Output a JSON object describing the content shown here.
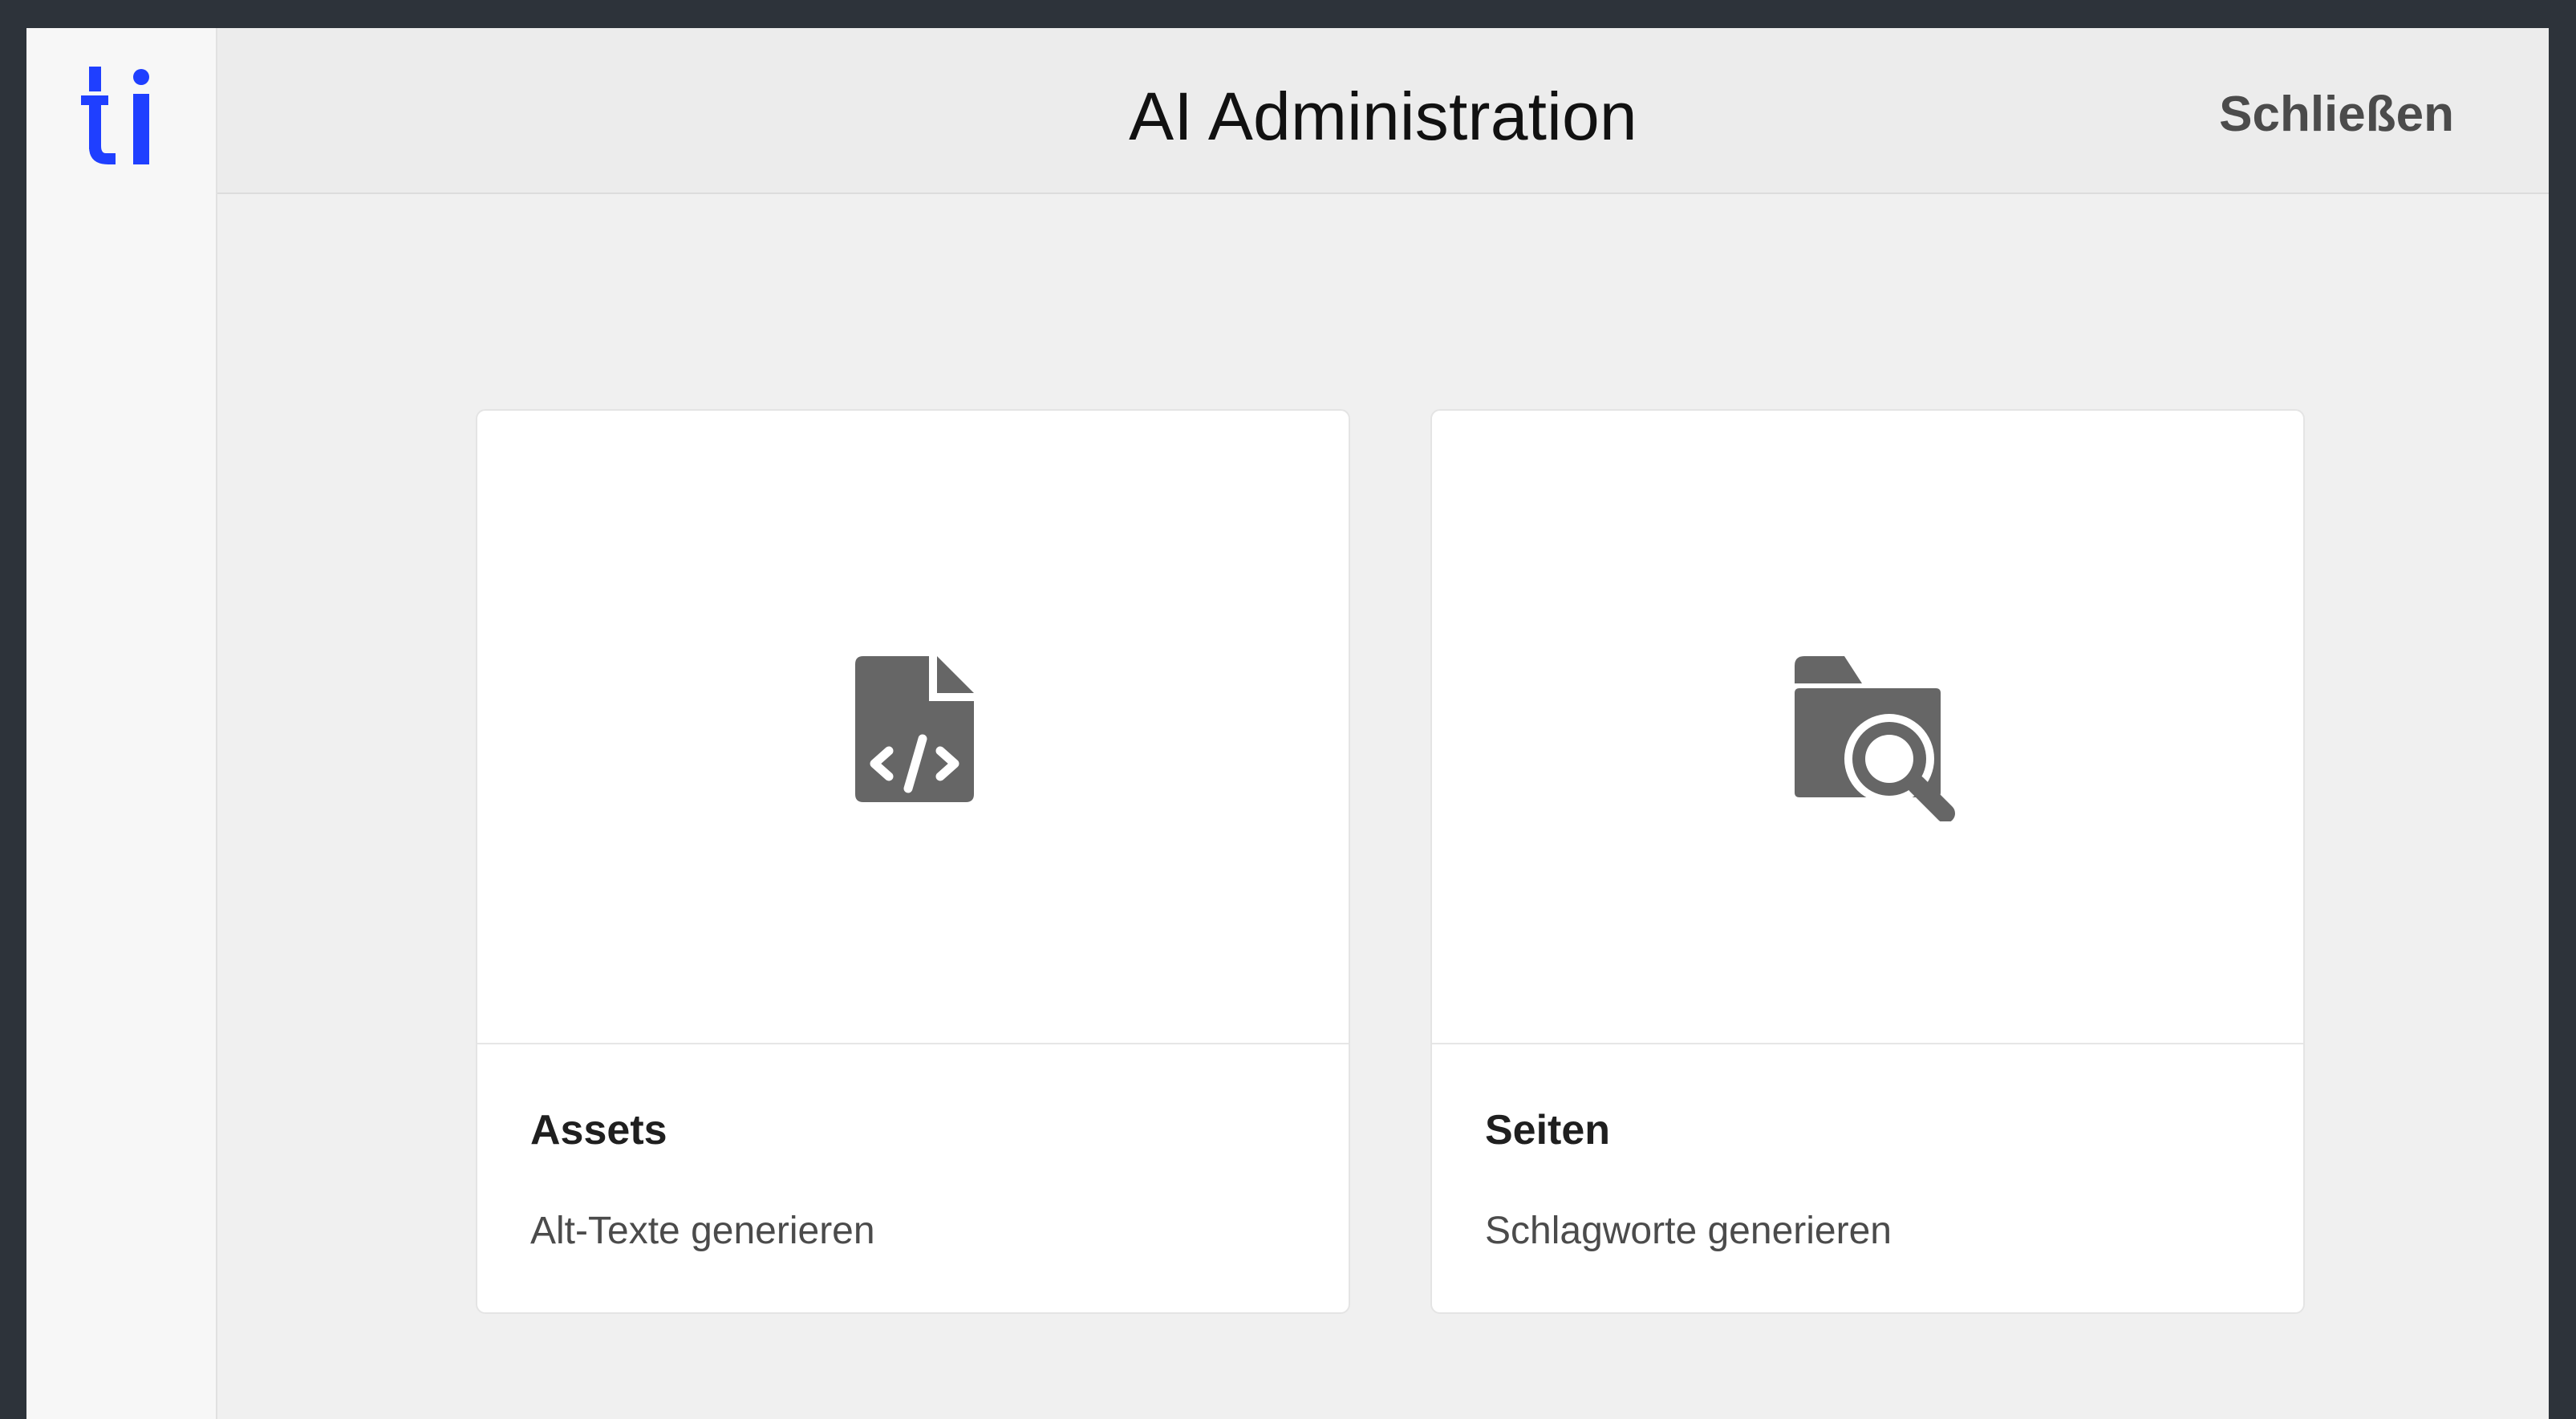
{
  "app": {
    "logo_text": "ti",
    "logo_color": "#1f3fff"
  },
  "header": {
    "title": "AI Administration",
    "close_label": "Schließen"
  },
  "cards": [
    {
      "title": "Assets",
      "subtitle": "Alt-Texte generieren",
      "icon": "file-code-icon"
    },
    {
      "title": "Seiten",
      "subtitle": "Schlagworte generieren",
      "icon": "folder-search-icon"
    }
  ],
  "colors": {
    "outer_background": "#2d333a",
    "content_background": "#f0f0f0",
    "header_background": "#ececec",
    "rail_background": "#f7f7f7",
    "card_background": "#ffffff",
    "icon_gray": "#666666",
    "title_text": "#111111",
    "secondary_text": "#4b4b4b"
  }
}
